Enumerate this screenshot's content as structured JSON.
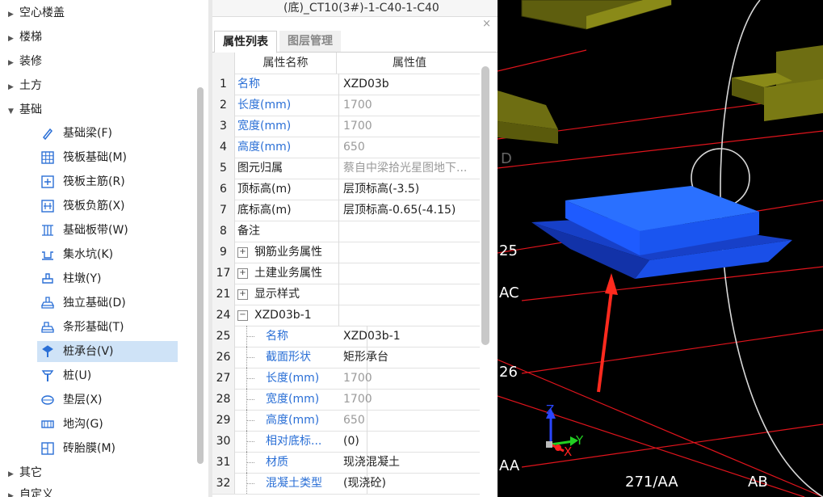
{
  "tree": {
    "categories_top": [
      "空心楼盖",
      "楼梯",
      "装修",
      "土方"
    ],
    "expanded_category": "基础",
    "items": [
      {
        "label": "基础梁(F)",
        "icon": "pencil-icon"
      },
      {
        "label": "筏板基础(M)",
        "icon": "grid-slab-icon"
      },
      {
        "label": "筏板主筋(R)",
        "icon": "rebar-main-icon"
      },
      {
        "label": "筏板负筋(X)",
        "icon": "rebar-negative-icon"
      },
      {
        "label": "基础板带(W)",
        "icon": "slab-strip-icon"
      },
      {
        "label": "集水坑(K)",
        "icon": "sump-pit-icon"
      },
      {
        "label": "柱墩(Y)",
        "icon": "column-pier-icon"
      },
      {
        "label": "独立基础(D)",
        "icon": "isolated-footing-icon"
      },
      {
        "label": "条形基础(T)",
        "icon": "strip-footing-icon"
      },
      {
        "label": "桩承台(V)",
        "icon": "pile-cap-icon",
        "selected": true
      },
      {
        "label": "桩(U)",
        "icon": "pile-icon"
      },
      {
        "label": "垫层(X)",
        "icon": "cushion-icon"
      },
      {
        "label": "地沟(G)",
        "icon": "trench-icon"
      },
      {
        "label": "砖胎膜(M)",
        "icon": "brick-mold-icon"
      }
    ],
    "categories_bottom": [
      "其它",
      "自定义"
    ]
  },
  "panel": {
    "top_text": "(底)_CT10(3#)-1-C40-1-C40",
    "close": "×",
    "tabs": [
      "属性列表",
      "图层管理"
    ],
    "header": {
      "name": "属性名称",
      "value": "属性值"
    },
    "rows": [
      {
        "num": "1",
        "name": "名称",
        "value": "XZD03b",
        "name_style": "blue",
        "value_style": "dark"
      },
      {
        "num": "2",
        "name": "长度(mm)",
        "value": "1700",
        "name_style": "blue",
        "value_style": "gray"
      },
      {
        "num": "3",
        "name": "宽度(mm)",
        "value": "1700",
        "name_style": "blue",
        "value_style": "gray"
      },
      {
        "num": "4",
        "name": "高度(mm)",
        "value": "650",
        "name_style": "blue",
        "value_style": "gray"
      },
      {
        "num": "5",
        "name": "图元归属",
        "value": "蔡自中梁拾光星图地下...",
        "name_style": "dark",
        "value_style": "gray"
      },
      {
        "num": "6",
        "name": "顶标高(m)",
        "value": "层顶标高(-3.5)",
        "name_style": "dark",
        "value_style": "dark"
      },
      {
        "num": "7",
        "name": "底标高(m)",
        "value": "层顶标高-0.65(-4.15)",
        "name_style": "dark",
        "value_style": "dark"
      },
      {
        "num": "8",
        "name": "备注",
        "value": "",
        "name_style": "dark",
        "value_style": "dark"
      },
      {
        "num": "9",
        "name": "钢筋业务属性",
        "value": "",
        "name_style": "dark",
        "value_style": "dark",
        "expander": "+"
      },
      {
        "num": "17",
        "name": "土建业务属性",
        "value": "",
        "name_style": "dark",
        "value_style": "dark",
        "expander": "+"
      },
      {
        "num": "21",
        "name": "显示样式",
        "value": "",
        "name_style": "dark",
        "value_style": "dark",
        "expander": "+"
      },
      {
        "num": "24",
        "name": "XZD03b-1",
        "value": "",
        "name_style": "dark",
        "value_style": "dark",
        "expander": "−"
      },
      {
        "num": "25",
        "name": "名称",
        "value": "XZD03b-1",
        "name_style": "blue",
        "value_style": "dark",
        "child": true
      },
      {
        "num": "26",
        "name": "截面形状",
        "value": "矩形承台",
        "name_style": "blue",
        "value_style": "dark",
        "child": true
      },
      {
        "num": "27",
        "name": "长度(mm)",
        "value": "1700",
        "name_style": "blue",
        "value_style": "gray",
        "child": true
      },
      {
        "num": "28",
        "name": "宽度(mm)",
        "value": "1700",
        "name_style": "blue",
        "value_style": "gray",
        "child": true
      },
      {
        "num": "29",
        "name": "高度(mm)",
        "value": "650",
        "name_style": "blue",
        "value_style": "gray",
        "child": true
      },
      {
        "num": "30",
        "name": "相对底标...",
        "value": "(0)",
        "name_style": "blue",
        "value_style": "dark",
        "child": true
      },
      {
        "num": "31",
        "name": "材质",
        "value": "现浇混凝土",
        "name_style": "blue",
        "value_style": "dark",
        "child": true
      },
      {
        "num": "32",
        "name": "混凝土类型",
        "value": "(现浇砼)",
        "name_style": "blue",
        "value_style": "dark",
        "child": true
      }
    ]
  },
  "view": {
    "grid_labels": [
      "D",
      "25",
      "AC",
      "26",
      "AA",
      "271/AA",
      "AB"
    ],
    "axes": {
      "x": "X",
      "y": "Y",
      "z": "Z"
    },
    "colors": {
      "background": "#000000",
      "grid_line": "#e0141c",
      "pile_cap": "#1e5bff",
      "existing_block": "#8a8a18",
      "arrow": "#ff2a1e"
    }
  }
}
